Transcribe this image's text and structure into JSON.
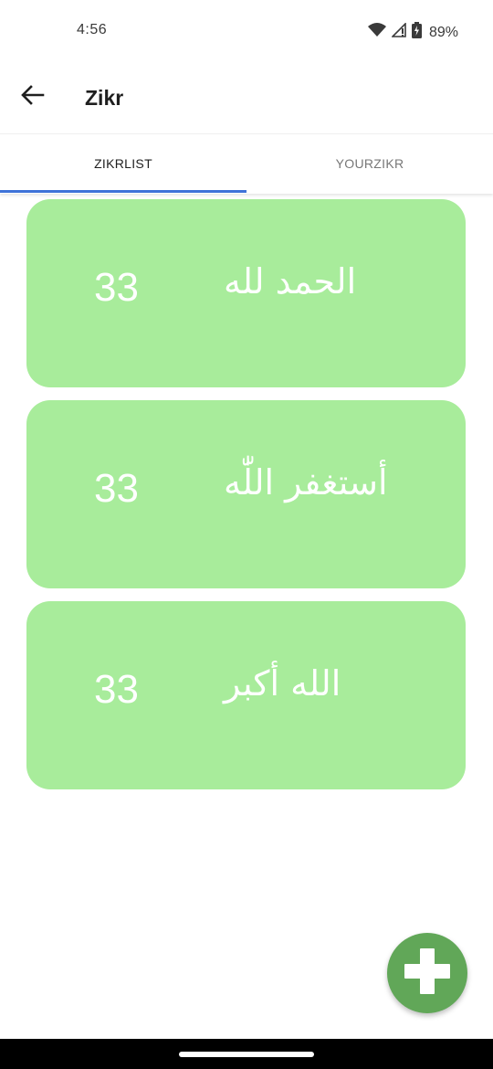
{
  "status_bar": {
    "time": "4:56",
    "battery": "89%",
    "icons": [
      "wifi-icon",
      "cell-signal-icon",
      "battery-charging-icon"
    ]
  },
  "app_bar": {
    "title": "Zikr",
    "back_icon": "arrow-left-icon"
  },
  "tabs": [
    {
      "label": "ZIKRLIST",
      "selected": true
    },
    {
      "label": "YOURZIKR",
      "selected": false
    }
  ],
  "zikr_list": [
    {
      "count": "33",
      "text": "الحمد لله"
    },
    {
      "count": "33",
      "text": "أستغفر اللّٰه"
    },
    {
      "count": "33",
      "text": "الله أكبر"
    }
  ],
  "fab": {
    "icon": "plus-icon"
  },
  "colors": {
    "card": "#a8ec9b",
    "fab": "#61a758",
    "tab_indicator": "#3f73d8"
  }
}
